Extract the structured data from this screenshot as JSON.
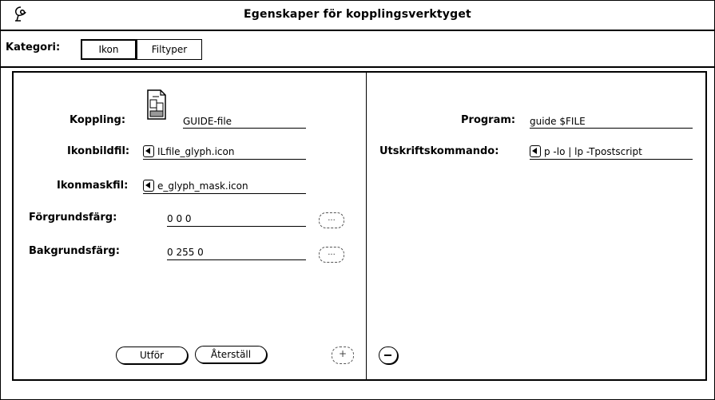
{
  "window": {
    "title": "Egenskaper för kopplingsverktyget"
  },
  "category": {
    "label": "Kategori:",
    "options": [
      "Ikon",
      "Filtyper"
    ],
    "selected": "Ikon"
  },
  "left_panel": {
    "koppling": {
      "label": "Koppling:",
      "value": "GUIDE-file"
    },
    "ikonbildfil": {
      "label": "Ikonbildfil:",
      "value": "ILfile_glyph.icon"
    },
    "ikonmaskfil": {
      "label": "Ikonmaskfil:",
      "value": "e_glyph_mask.icon"
    },
    "forgrundsfarg": {
      "label": "Förgrundsfärg:",
      "value": "0 0 0",
      "chooser_label": "..."
    },
    "bakgrundsfarg": {
      "label": "Bakgrundsfärg:",
      "value": "0 255 0",
      "chooser_label": "..."
    },
    "apply_label": "Utför",
    "reset_label": "Återställ",
    "plus_label": "+"
  },
  "right_panel": {
    "program": {
      "label": "Program:",
      "value": "guide $FILE"
    },
    "utskrift": {
      "label": "Utskriftskommando:",
      "value": "p -lo | lp -Tpostscript"
    }
  }
}
